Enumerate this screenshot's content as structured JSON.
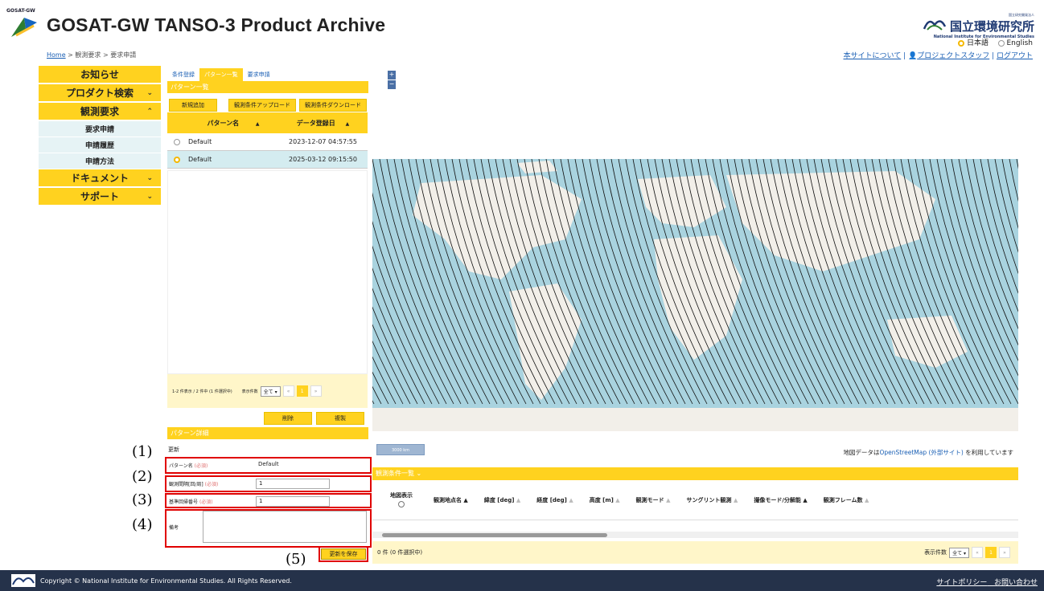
{
  "header": {
    "logo_text": "GOSAT-GW",
    "title": "GOSAT-GW TANSO-3 Product Archive",
    "institute_jp_small": "国立研究開発法人",
    "institute_jp": "国立環境研究所",
    "institute_en": "National Institute for Environmental Studies"
  },
  "breadcrumb": {
    "home": "Home",
    "sep1": " > ",
    "item1": "観測要求",
    "sep2": " > ",
    "item2": "要求申請"
  },
  "language": {
    "ja": "日本語",
    "en": "English",
    "selected": "ja"
  },
  "top_links": {
    "about": "本サイトについて",
    "staff": "プロジェクトスタッフ",
    "logout": "ログアウト",
    "sep": " | "
  },
  "sidebar": {
    "items": [
      {
        "label": "お知らせ",
        "chevron": ""
      },
      {
        "label": "プロダクト検索",
        "chevron": "⌄"
      },
      {
        "label": "観測要求",
        "chevron": "⌃"
      },
      {
        "label": "ドキュメント",
        "chevron": "⌄"
      },
      {
        "label": "サポート",
        "chevron": "⌄"
      }
    ],
    "subitems": [
      "要求申請",
      "申請履歴",
      "申請方法"
    ]
  },
  "tabs": [
    "条件登録",
    "パターン一覧",
    "要求申請"
  ],
  "pattern_list": {
    "title": "パターン一覧",
    "buttons": {
      "new": "新規追加",
      "upload": "観測条件アップロード",
      "download": "観測条件ダウンロード"
    },
    "columns": [
      "パターン名",
      "データ登録日"
    ],
    "sort_icon": "▲",
    "rows": [
      {
        "name": "Default",
        "date": "2023-12-07 04:57:55",
        "selected": false
      },
      {
        "name": "Default",
        "date": "2025-03-12 09:15:50",
        "selected": true
      }
    ],
    "pager_text": "1-2 件表示 / 2 件中 (1 件選択中)",
    "per_page_label": "表示件数",
    "per_page_value": "全て",
    "page_first": "«",
    "page_current": "1",
    "page_last": "»",
    "delete": "削除",
    "copy": "複製"
  },
  "detail": {
    "title": "パターン詳細",
    "mode": "更新",
    "required": "(必須)",
    "fields": [
      {
        "label": "パターン名",
        "value": "Default"
      },
      {
        "label": "観測間隔[回/周]",
        "value": "1"
      },
      {
        "label": "基準回帰番号",
        "value": "1"
      }
    ],
    "notes_label": "備考",
    "notes_value": "",
    "save": "更新を保存"
  },
  "annotations": [
    "(1)",
    "(2)",
    "(3)",
    "(4)",
    "(5)"
  ],
  "map": {
    "zoom_in": "+",
    "zoom_out": "−",
    "scale_label": "3000 km",
    "attribution_prefix": "地図データは",
    "attribution_link": "OpenStreetMap (外部サイト)",
    "attribution_suffix": " を利用しています",
    "ocean_color": "#a9d3df",
    "land_color": "#f2efe9"
  },
  "obs_list": {
    "title": "観測条件一覧",
    "columns": [
      "地図表示",
      "観測地点名",
      "緯度 [deg]",
      "経度 [deg]",
      "高度 [m]",
      "観測モード",
      "サングリント観測",
      "撮像モード/分解能",
      "観測フレーム数"
    ],
    "pager_text": "0 件 (0 件選択中)",
    "per_page_label": "表示件数",
    "per_page_value": "全て"
  },
  "footer": {
    "copyright": "Copyright © National Institute for Environmental Studies. All Rights Reserved.",
    "policy": "サイトポリシー",
    "contact": "お問い合わせ"
  }
}
